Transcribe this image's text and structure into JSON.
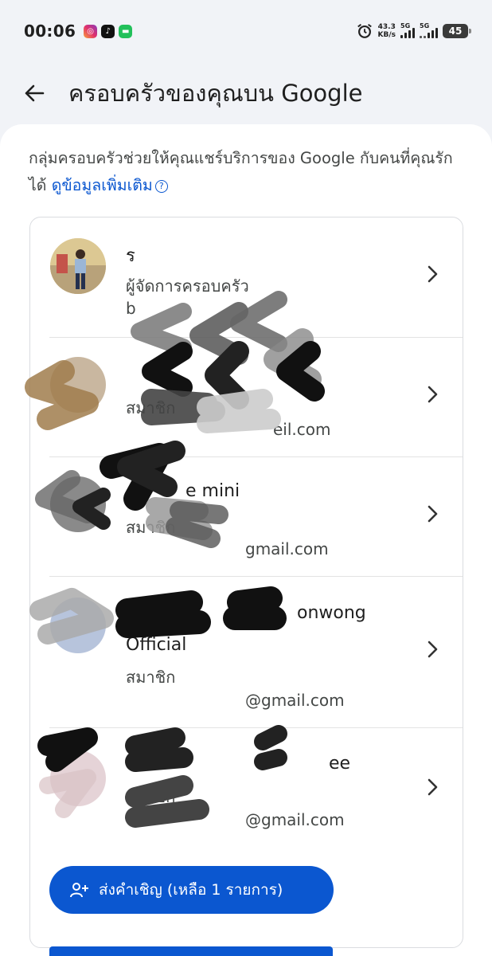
{
  "status_bar": {
    "time": "00:06",
    "net_speed_value": "43.3",
    "net_speed_unit": "KB/s",
    "sim1": "5G",
    "sim2": "5G",
    "battery": "45"
  },
  "header": {
    "title": "ครอบครัวของคุณบน Google"
  },
  "intro": {
    "text": "กลุ่มครอบครัวช่วยให้คุณแชร์บริการของ Google กับคนที่คุณรักได้",
    "link": "ดูข้อมูลเพิ่มเติม"
  },
  "members": [
    {
      "name": "ร",
      "role": "ผู้จัดการครอบครัว",
      "email": "b"
    },
    {
      "name": "",
      "role": "สมาชิก",
      "email": "eil.com"
    },
    {
      "name": "e mini",
      "role": "สมาชิก",
      "email": "gmail.com"
    },
    {
      "name": "onwong",
      "name2": "Official",
      "role": "สมาชิก",
      "email": "@gmail.com"
    },
    {
      "name": "ee",
      "role": "สมาชิก",
      "email": "@gmail.com"
    }
  ],
  "invite_button": {
    "label": "ส่งคำเชิญ (เหลือ 1 รายการ)"
  },
  "colors": {
    "primary": "#0b57d0",
    "background": "#f1f3f7",
    "card_border": "#dadce0"
  }
}
